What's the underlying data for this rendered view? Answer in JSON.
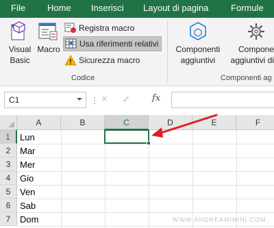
{
  "tabs": [
    "File",
    "Home",
    "Inserisci",
    "Layout di pagina",
    "Formule"
  ],
  "ribbon": {
    "visual_basic_label": [
      "Visual",
      "Basic"
    ],
    "macro_label": "Macro",
    "registra_macro": "Registra macro",
    "usa_riferimenti_relativi": "Usa riferimenti relativi",
    "sicurezza_macro": "Sicurezza macro",
    "group_codice": "Codice",
    "componenti_aggiuntivi_label": [
      "Componenti",
      "aggiuntivi"
    ],
    "componenti_excel_label": [
      "Compone",
      "aggiuntivi di E"
    ],
    "group_componenti": "Componenti ag"
  },
  "formula_bar": {
    "name_box": "C1",
    "cancel_icon": "×",
    "enter_icon": "✓",
    "fx": "fx",
    "value": ""
  },
  "grid": {
    "columns": [
      "A",
      "B",
      "C",
      "D",
      "E",
      "F"
    ],
    "rows": [
      "1",
      "2",
      "3",
      "4",
      "5",
      "6",
      "7"
    ],
    "selected_cell": "C1",
    "column_a": [
      "Lun",
      "Mar",
      "Mer",
      "Gio",
      "Ven",
      "Sab",
      "Dom"
    ]
  },
  "watermark": "WWW.ANDREAMININI.COM",
  "colors": {
    "ribbon_green": "#217346",
    "arrow_red": "#e02020"
  },
  "icons": {
    "visual_basic": "vba-cube-icon",
    "macro": "macro-window-icon",
    "registra": "record-macro-icon",
    "riferimenti": "relative-reference-grid-icon",
    "sicurezza": "warning-triangle-icon",
    "componenti": "hexagon-addin-icon",
    "componenti_excel": "gear-addin-icon"
  }
}
